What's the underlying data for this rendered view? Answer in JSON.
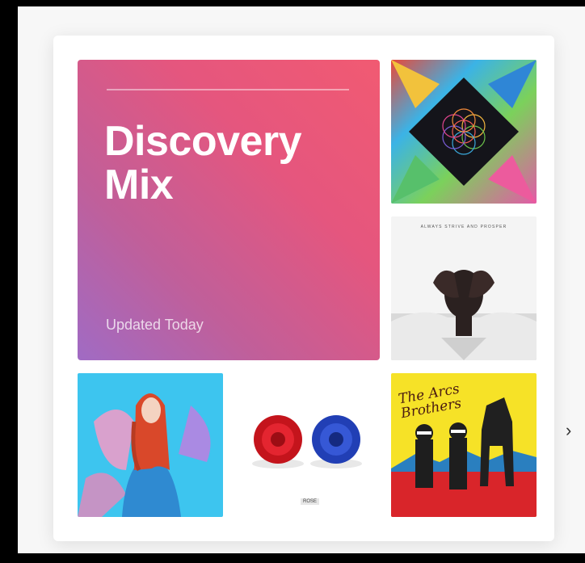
{
  "mix": {
    "title_line1": "Discovery",
    "title_line2": "Mix",
    "subtitle": "Updated Today"
  },
  "albums": [
    {
      "art": "kaleidoscope-flower-of-life-art"
    },
    {
      "art": "portrait-with-hands-over-face-art",
      "caption": "ALWAYS STRIVE AND PROSPER"
    },
    {
      "art": "redhead-in-blue-coat-art"
    },
    {
      "art": "red-and-blue-roses-art",
      "tag": "ROSE"
    },
    {
      "art": "yellow-poster-two-figures-and-horse-art",
      "scribble": "The Arcs Brothers"
    }
  ],
  "colors": {
    "gradient_start": "#f15a72",
    "gradient_end": "#a06bc4",
    "accent_yellow": "#f6e227"
  }
}
